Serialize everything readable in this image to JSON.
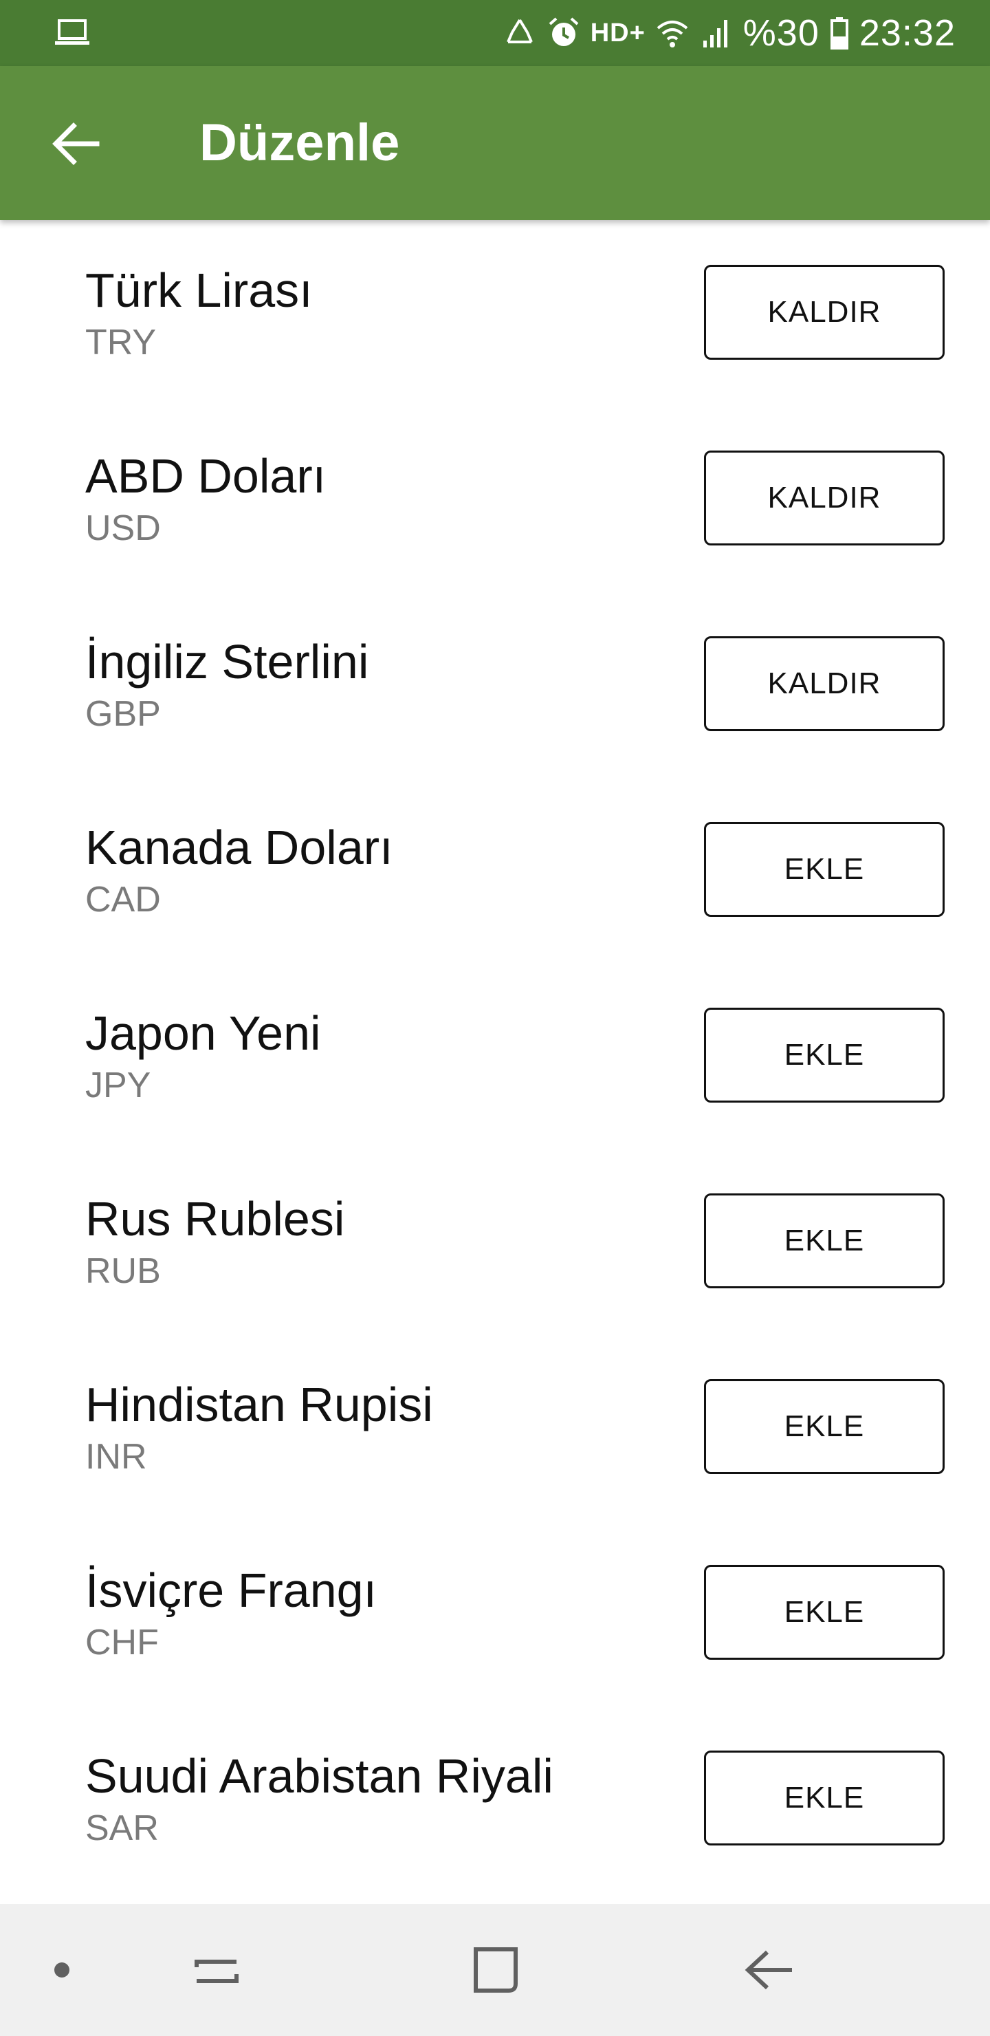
{
  "status_bar": {
    "left_icon": "laptop-icon",
    "icons": [
      "recycle-icon",
      "alarm-icon"
    ],
    "network_label": "HD+",
    "wifi_icon": "wifi-icon",
    "signal_icon": "signal-icon",
    "battery_percent": "%30",
    "battery_icon": "battery-icon",
    "time": "23:32"
  },
  "app_bar": {
    "back_icon": "arrow-back-icon",
    "title": "Düzenle",
    "background_color": "#5e8f3f"
  },
  "currencies": [
    {
      "name": "Türk Lirası",
      "code": "TRY",
      "action": "KALDIR"
    },
    {
      "name": "ABD Doları",
      "code": "USD",
      "action": "KALDIR"
    },
    {
      "name": "İngiliz Sterlini",
      "code": "GBP",
      "action": "KALDIR"
    },
    {
      "name": "Kanada Doları",
      "code": "CAD",
      "action": "EKLE"
    },
    {
      "name": "Japon Yeni",
      "code": "JPY",
      "action": "EKLE"
    },
    {
      "name": "Rus Rublesi",
      "code": "RUB",
      "action": "EKLE"
    },
    {
      "name": "Hindistan Rupisi",
      "code": "INR",
      "action": "EKLE"
    },
    {
      "name": "İsviçre Frangı",
      "code": "CHF",
      "action": "EKLE"
    },
    {
      "name": "Suudi Arabistan Riyali",
      "code": "SAR",
      "action": "EKLE"
    }
  ],
  "nav_bar": {
    "items": [
      "dot-icon",
      "recent-apps-icon",
      "home-icon",
      "back-icon"
    ]
  }
}
